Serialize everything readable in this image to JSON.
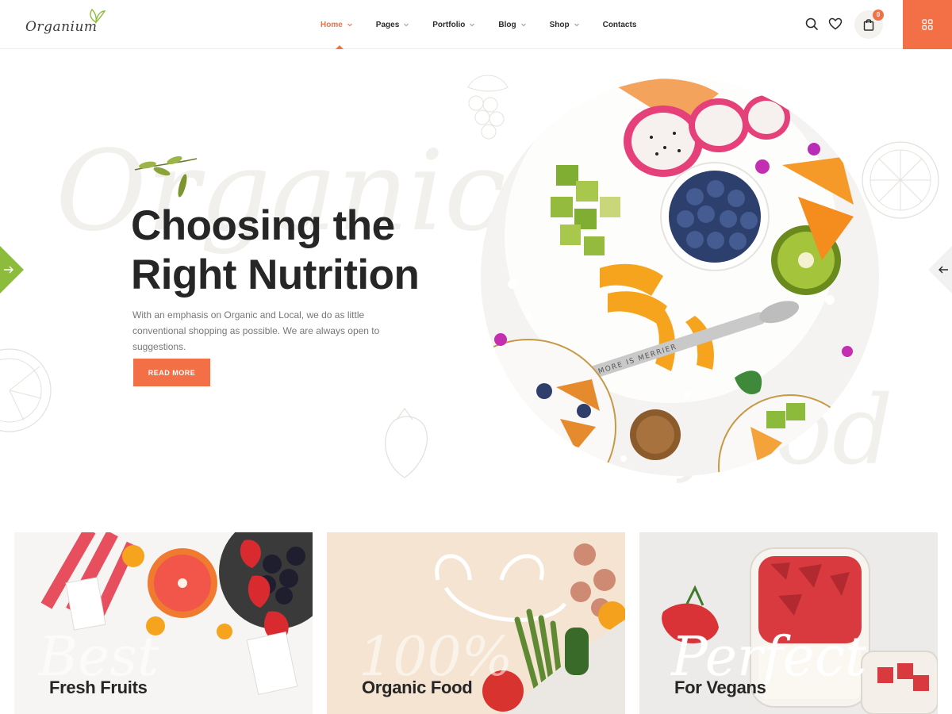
{
  "brand": {
    "logo_text": "Organium"
  },
  "nav": {
    "items": [
      {
        "label": "Home",
        "active": true,
        "has_dropdown": true
      },
      {
        "label": "Pages",
        "has_dropdown": true
      },
      {
        "label": "Portfolio",
        "has_dropdown": true
      },
      {
        "label": "Blog",
        "has_dropdown": true
      },
      {
        "label": "Shop",
        "has_dropdown": true
      },
      {
        "label": "Contacts",
        "has_dropdown": false
      }
    ]
  },
  "header_icons": {
    "search": "search-icon",
    "wishlist": "heart-icon",
    "cart": "shopping-bag-icon",
    "cart_count": "0",
    "menu": "grid-menu-icon"
  },
  "hero": {
    "background_script_1": "Organic",
    "background_script_2": "food",
    "title_line_1": "Choosing the",
    "title_line_2": "Right Nutrition",
    "text": "With an emphasis on Organic and Local, we do as little conventional shopping as possible. We are always open to suggestions.",
    "button_label": "READ MORE",
    "spoon_text": "MORE IS MERRIER"
  },
  "cards": [
    {
      "script": "Best",
      "title": "Fresh Fruits"
    },
    {
      "script": "100%",
      "title": "Organic Food"
    },
    {
      "script": "Perfect",
      "title": "For Vegans"
    }
  ],
  "colors": {
    "accent": "#f36f46",
    "slider_left_arrow": "#8dbb3b",
    "text_dark": "#262626",
    "text_muted": "#777777"
  }
}
